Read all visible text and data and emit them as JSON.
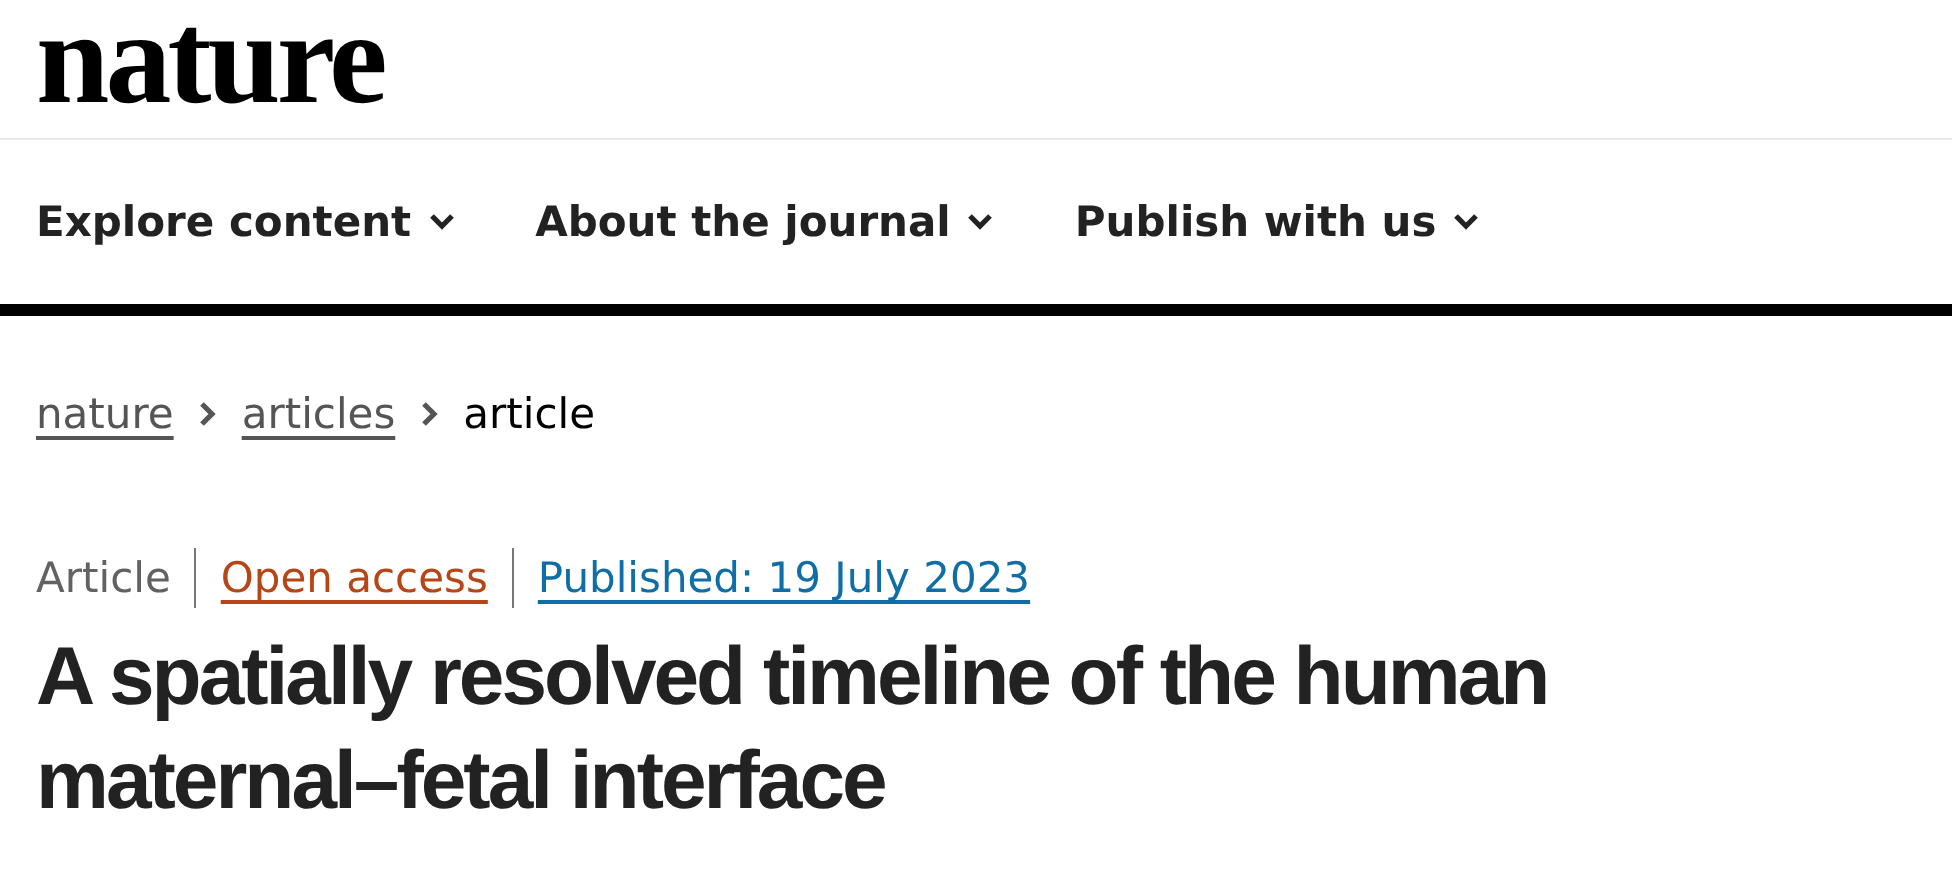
{
  "logo": {
    "text": "nature"
  },
  "nav": [
    {
      "label": "Explore content"
    },
    {
      "label": "About the journal"
    },
    {
      "label": "Publish with us"
    }
  ],
  "breadcrumbs": [
    {
      "label": "nature",
      "current": false
    },
    {
      "label": "articles",
      "current": false
    },
    {
      "label": "article",
      "current": true
    }
  ],
  "meta": [
    {
      "text": "Article",
      "link": false,
      "color": "#626262"
    },
    {
      "text": "Open access",
      "link": true,
      "color": "#b74616"
    },
    {
      "text": "Published: 19 July 2023",
      "link": true,
      "color": "#0f6ea5"
    }
  ],
  "title": "A spatially resolved timeline of the human maternal–fetal interface"
}
